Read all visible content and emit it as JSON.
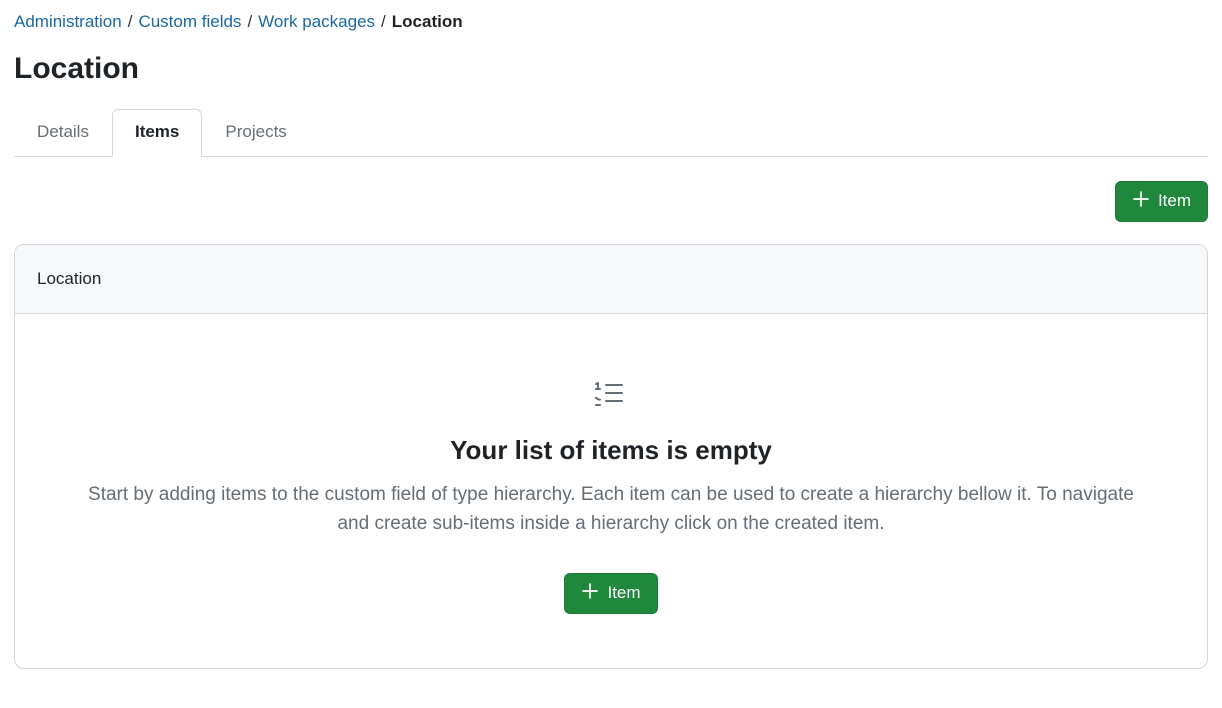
{
  "breadcrumb": {
    "items": [
      {
        "label": "Administration"
      },
      {
        "label": "Custom fields"
      },
      {
        "label": "Work packages"
      }
    ],
    "current": "Location",
    "separator": "/"
  },
  "page_title": "Location",
  "tabs": {
    "details": "Details",
    "items": "Items",
    "projects": "Projects"
  },
  "buttons": {
    "add_item": "Item"
  },
  "card": {
    "header": "Location",
    "empty_title": "Your list of items is empty",
    "empty_desc": "Start by adding items to the custom field of type hierarchy. Each item can be used to create a hierarchy bellow it. To navigate and create sub-items inside a hierarchy click on the created item."
  }
}
